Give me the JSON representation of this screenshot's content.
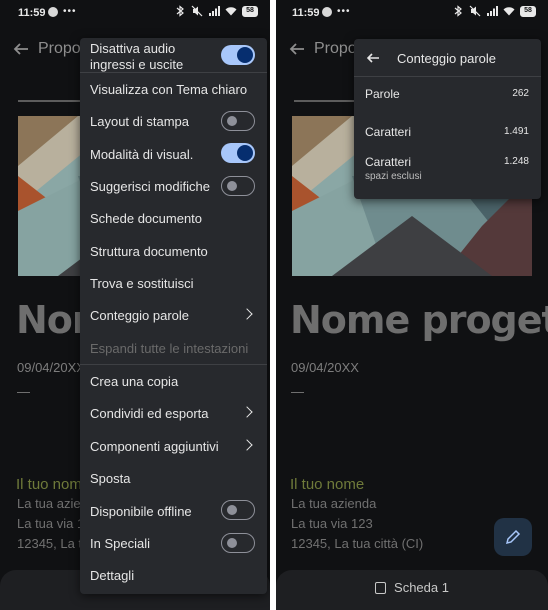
{
  "status": {
    "time": "11:59",
    "battery": "58"
  },
  "document": {
    "title_truncated": "Propo",
    "heading": "Nome progetto",
    "heading_truncated": "Nom",
    "date": "09/04/20XX",
    "dash": "—",
    "your_name": "Il tuo nome",
    "company": "La tua azienda",
    "street": "La tua via 123",
    "city": "12345, La tua città (CI)",
    "city_truncated": "12345, La tua"
  },
  "bottom_bar": {
    "tab_label": "Scheda 1"
  },
  "menu": {
    "items": [
      {
        "label": "Disattiva audio ingressi e uscite",
        "label_line1": "Disattiva audio",
        "label_line2": "ingressi e uscite",
        "control": "toggle",
        "on": true
      },
      {
        "label": "Visualizza con Tema chiaro"
      },
      {
        "label": "Layout di stampa",
        "control": "toggle",
        "on": false
      },
      {
        "label": "Modalità di visual.",
        "control": "toggle",
        "on": true
      },
      {
        "label": "Suggerisci modifiche",
        "control": "toggle",
        "on": false
      },
      {
        "label": "Schede documento"
      },
      {
        "label": "Struttura documento"
      },
      {
        "label": "Trova e sostituisci"
      },
      {
        "label": "Conteggio parole",
        "control": "submenu"
      },
      {
        "label": "Espandi tutte le intestazioni",
        "disabled": true
      },
      {
        "label": "Crea una copia"
      },
      {
        "label": "Condividi ed esporta",
        "control": "submenu"
      },
      {
        "label": "Componenti aggiuntivi",
        "control": "submenu"
      },
      {
        "label": "Sposta"
      },
      {
        "label": "Disponibile offline",
        "control": "toggle",
        "on": false
      },
      {
        "label": "In Speciali",
        "control": "toggle",
        "on": false
      },
      {
        "label": "Dettagli"
      }
    ]
  },
  "word_count": {
    "title": "Conteggio parole",
    "rows": [
      {
        "label": "Parole",
        "value": "262"
      },
      {
        "label": "Caratteri",
        "value": "1.491"
      },
      {
        "label": "Caratteri",
        "value": "1.248",
        "sub": "spazi esclusi"
      }
    ]
  },
  "colors": {
    "background": "#101113",
    "menu_bg": "#27292d",
    "toggle_on": "#a8c7fa",
    "accent_name": "#6f7a3a"
  },
  "icons": [
    "telegram-icon",
    "bluetooth-icon",
    "mute-icon",
    "signal-icon",
    "wifi-icon",
    "battery-icon",
    "back-arrow-icon",
    "chevron-right-icon",
    "edit-icon",
    "tab-icon"
  ]
}
